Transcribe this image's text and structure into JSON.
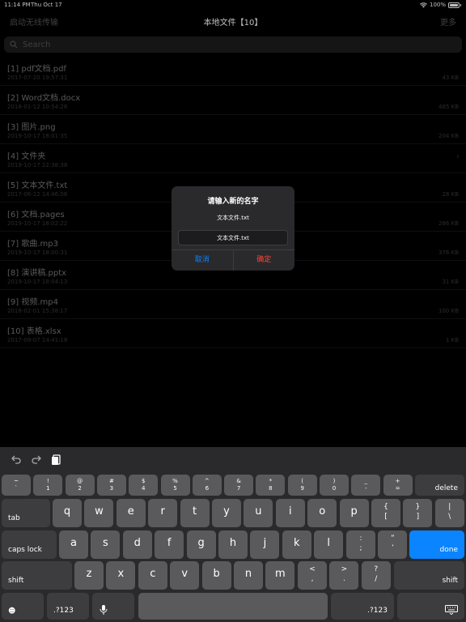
{
  "status": {
    "time": "11:14 PM",
    "date": "Thu Oct 17",
    "battery": "100%"
  },
  "nav": {
    "left": "启动无线传输",
    "title": "本地文件【10】",
    "right": "更多"
  },
  "search": {
    "placeholder": "Search"
  },
  "files": [
    {
      "name": "[1] pdf文档.pdf",
      "date": "2017-07-20 19:57:31",
      "size": "43 KB"
    },
    {
      "name": "[2] Word文档.docx",
      "date": "2018-01-12 10:54:26",
      "size": "465 KB"
    },
    {
      "name": "[3] 图片.png",
      "date": "2019-10-17 18:01:35",
      "size": "204 KB"
    },
    {
      "name": "[4] 文件夹",
      "date": "2019-10-17 22:38:38",
      "size": ""
    },
    {
      "name": "[5] 文本文件.txt",
      "date": "2017-06-12 14:46:06",
      "size": "28 KB"
    },
    {
      "name": "[6] 文档.pages",
      "date": "2019-10-17 18:02:22",
      "size": "286 KB"
    },
    {
      "name": "[7] 歌曲.mp3",
      "date": "2019-10-17 18:00:31",
      "size": "376 KB"
    },
    {
      "name": "[8] 演讲稿.pptx",
      "date": "2019-10-17 18:04:13",
      "size": "31 KB"
    },
    {
      "name": "[9] 视频.mp4",
      "date": "2018-02-01 15:38:17",
      "size": "100 KB"
    },
    {
      "name": "[10] 表格.xlsx",
      "date": "2017-09-07 14:41:18",
      "size": "1 KB"
    }
  ],
  "dialog": {
    "title": "请输入新的名字",
    "message": "文本文件.txt",
    "input_value": "文本文件.txt",
    "cancel": "取消",
    "confirm": "确定"
  },
  "keyboard": {
    "row1": [
      {
        "top": "~",
        "bottom": "`"
      },
      {
        "top": "!",
        "bottom": "1"
      },
      {
        "top": "@",
        "bottom": "2"
      },
      {
        "top": "#",
        "bottom": "3"
      },
      {
        "top": "$",
        "bottom": "4"
      },
      {
        "top": "%",
        "bottom": "5"
      },
      {
        "top": "^",
        "bottom": "6"
      },
      {
        "top": "&",
        "bottom": "7"
      },
      {
        "top": "*",
        "bottom": "8"
      },
      {
        "top": "(",
        "bottom": "9"
      },
      {
        "top": ")",
        "bottom": "0"
      },
      {
        "top": "_",
        "bottom": "-"
      },
      {
        "top": "+",
        "bottom": "="
      }
    ],
    "delete": "delete",
    "tab": "tab",
    "row2": [
      "q",
      "w",
      "e",
      "r",
      "t",
      "y",
      "u",
      "i",
      "o",
      "p"
    ],
    "row2_sym": [
      {
        "top": "{",
        "bottom": "["
      },
      {
        "top": "}",
        "bottom": "]"
      },
      {
        "top": "|",
        "bottom": "\\"
      }
    ],
    "caps": "caps lock",
    "row3": [
      "a",
      "s",
      "d",
      "f",
      "g",
      "h",
      "j",
      "k",
      "l"
    ],
    "row3_sym": [
      {
        "top": ":",
        "bottom": ";"
      },
      {
        "top": "”",
        "bottom": "’"
      }
    ],
    "done": "done",
    "shift": "shift",
    "row4": [
      "z",
      "x",
      "c",
      "v",
      "b",
      "n",
      "m"
    ],
    "row4_sym": [
      {
        "top": "<",
        "bottom": ","
      },
      {
        "top": ">",
        "bottom": "."
      },
      {
        "top": "?",
        "bottom": "/"
      }
    ],
    "numbers": ".?123"
  }
}
